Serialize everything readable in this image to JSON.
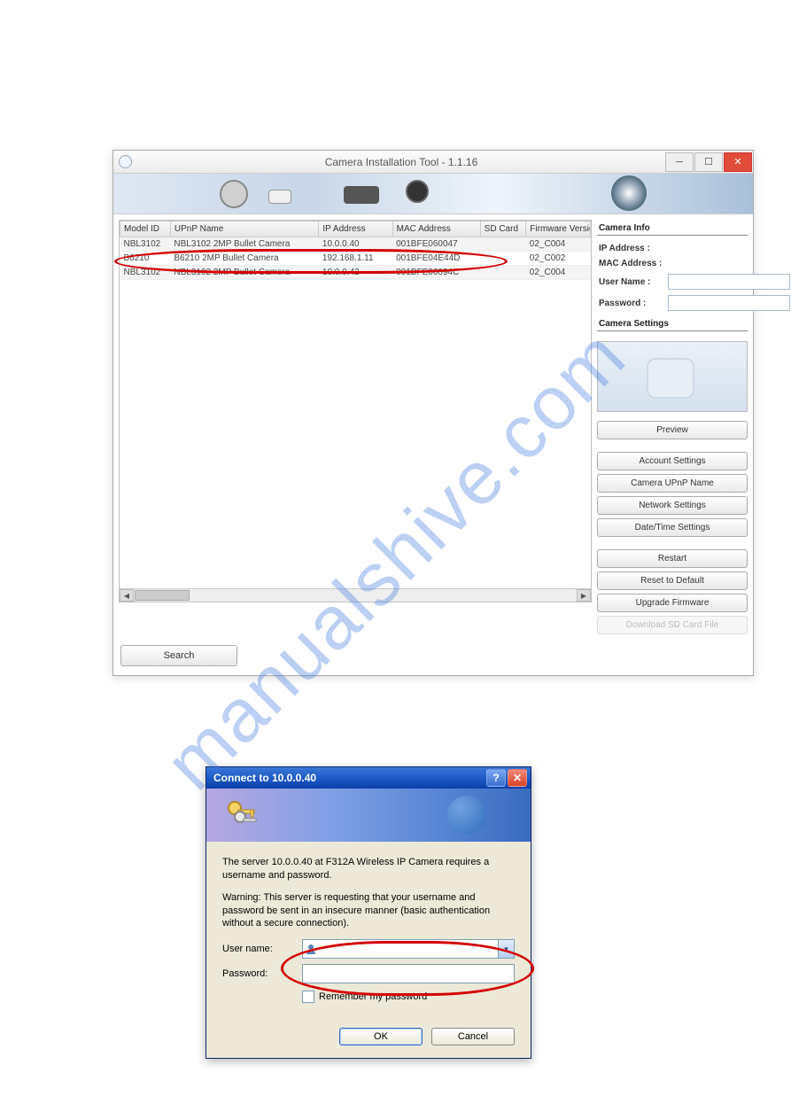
{
  "watermark": "manualshive.com",
  "win1": {
    "title": "Camera Installation Tool - 1.1.16",
    "columns": [
      "Model ID",
      "UPnP Name",
      "IP Address",
      "MAC Address",
      "SD Card",
      "Firmware Versio"
    ],
    "rows": [
      {
        "model": "NBL3102",
        "upnp": "NBL3102 2MP Bullet Camera",
        "ip": "10.0.0.40",
        "mac": "001BFE060047",
        "sd": "",
        "fw": "02_C004"
      },
      {
        "model": "B6210",
        "upnp": "B6210  2MP Bullet Camera",
        "ip": "192.168.1.11",
        "mac": "001BFE04E44D",
        "sd": "",
        "fw": "02_C002"
      },
      {
        "model": "NBL3102",
        "upnp": "NBL3102 2MP Bullet Camera",
        "ip": "10.0.0.42",
        "mac": "001BFE06094C",
        "sd": "",
        "fw": "02_C004"
      }
    ],
    "info_header": "Camera Info",
    "labels": {
      "ip": "IP Address :",
      "mac": "MAC Address :",
      "user": "User Name :",
      "pwd": "Password :"
    },
    "settings_header": "Camera Settings",
    "buttons": {
      "preview": "Preview",
      "account": "Account Settings",
      "upnp": "Camera UPnP Name",
      "network": "Network Settings",
      "datetime": "Date/Time Settings",
      "restart": "Restart",
      "reset": "Reset to Default",
      "upgrade": "Upgrade Firmware",
      "download": "Download SD Card File"
    },
    "search": "Search"
  },
  "win2": {
    "title": "Connect to 10.0.0.40",
    "msg1": "The server 10.0.0.40 at F312A Wireless IP Camera requires a username and password.",
    "msg2": "Warning: This server is requesting that your username and password be sent in an insecure manner (basic authentication without a secure connection).",
    "user_label": "User name:",
    "pwd_label": "Password:",
    "remember": "Remember my password",
    "ok": "OK",
    "cancel": "Cancel",
    "user_value": "",
    "pwd_value": ""
  }
}
